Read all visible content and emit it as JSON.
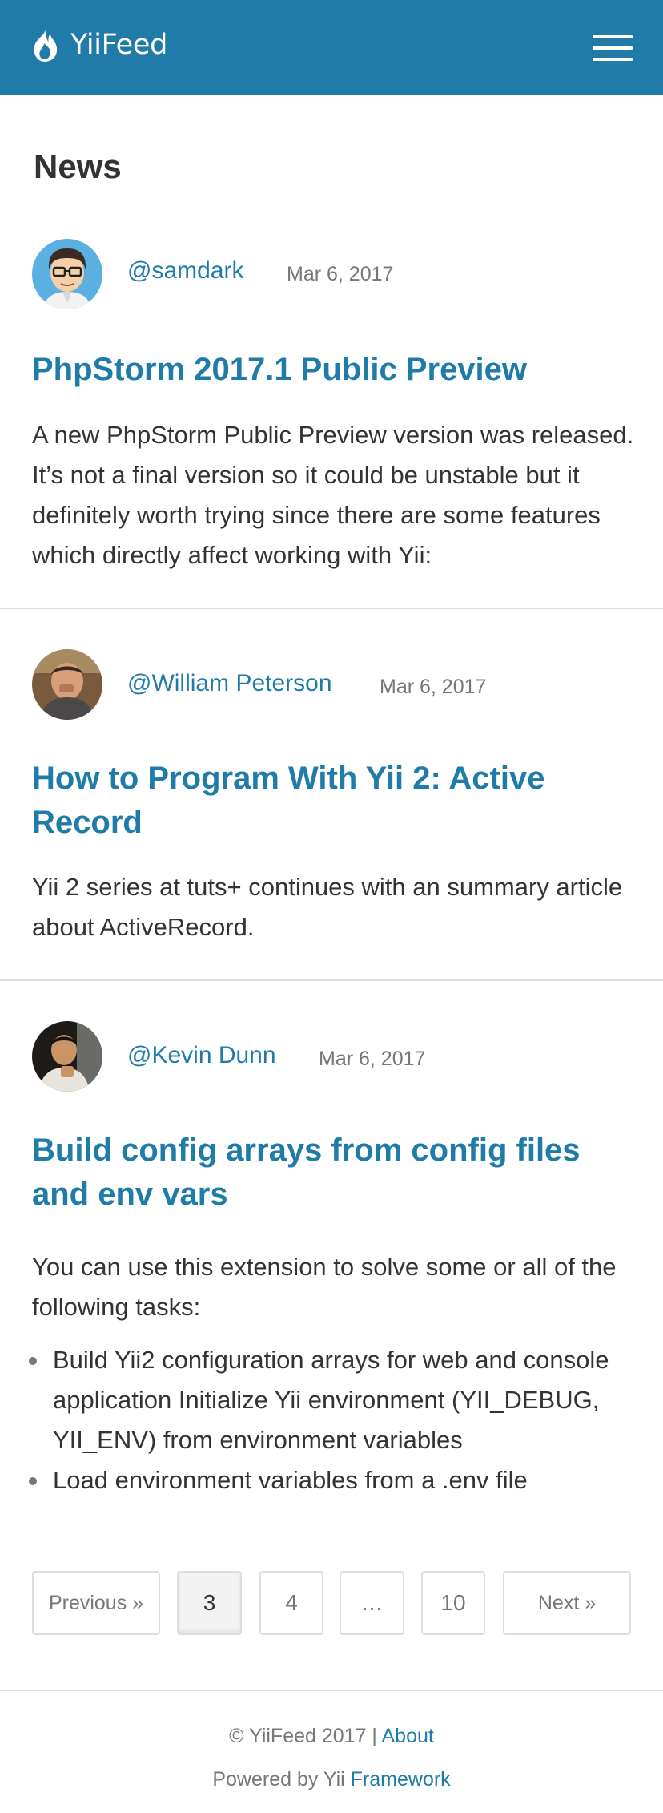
{
  "header": {
    "brand": "YiiFeed",
    "brand_icon": "flame-icon",
    "menu_icon": "hamburger-menu-icon",
    "color": "#217ba8"
  },
  "page": {
    "title": "News"
  },
  "posts": [
    {
      "author": "@samdark",
      "date": "Mar 6, 2017",
      "title": "PhpStorm 2017.1 Public Preview",
      "body": "A new PhpStorm Public Preview version was released. It’s not a final version so it could be unstable but it definitely worth trying since there are some features which directly affect working with Yii:"
    },
    {
      "author": "@William Peterson",
      "date": "Mar 6, 2017",
      "title": "How to Program With Yii 2: Active Record",
      "body": "Yii 2 series at tuts+ continues with an summary article about ActiveRecord."
    },
    {
      "author": "@Kevin Dunn",
      "date": "Mar 6, 2017",
      "title": "Build config arrays from config files and env vars",
      "body": "You can use this extension to solve some or all of the following tasks:",
      "list": [
        "Build Yii2 configuration arrays for web and console application Initialize Yii environment (YII_DEBUG, YII_ENV) from environment variables",
        "Load environment variables from a .env file"
      ]
    }
  ],
  "pagination": {
    "previous": "Previous »",
    "pages": [
      "3",
      "4",
      "…",
      "10"
    ],
    "current": "3",
    "next": "Next »"
  },
  "footer": {
    "copyright": "© YiiFeed 2017 |",
    "about": "About",
    "powered": "Powered by Yii",
    "framework": "Framework"
  },
  "colors": {
    "link": "#1f7ba8",
    "text": "#333333",
    "muted": "#777777",
    "divider": "#dddddd"
  }
}
